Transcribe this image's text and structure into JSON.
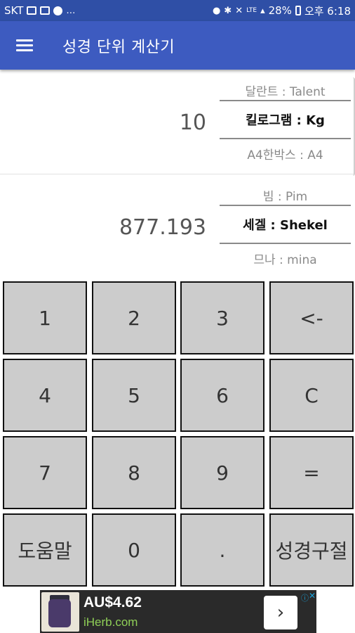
{
  "status_bar": {
    "carrier": "SKT",
    "battery": "28%",
    "time": "오후 6:18",
    "network": "LTE"
  },
  "app_bar": {
    "title": "성경 단위 계산기"
  },
  "row1": {
    "value": "10",
    "unit_above": "달란트 : Talent",
    "unit_selected": "킬로그램 : Kg",
    "unit_below": "A4한박스 : A4"
  },
  "row2": {
    "value": "877.193",
    "unit_above": "빔 : Pim",
    "unit_selected": "세겔 : Shekel",
    "unit_below": "므나 : mina"
  },
  "keypad": {
    "k1": "1",
    "k2": "2",
    "k3": "3",
    "backspace": "<-",
    "k4": "4",
    "k5": "5",
    "k6": "6",
    "clear": "C",
    "k7": "7",
    "k8": "8",
    "k9": "9",
    "equals": "=",
    "help": "도움말",
    "k0": "0",
    "dot": ".",
    "verse": "성경구절"
  },
  "ad": {
    "price": "AU$4.62",
    "site": "iHerb.com",
    "next_icon": "chevron-right-icon"
  }
}
